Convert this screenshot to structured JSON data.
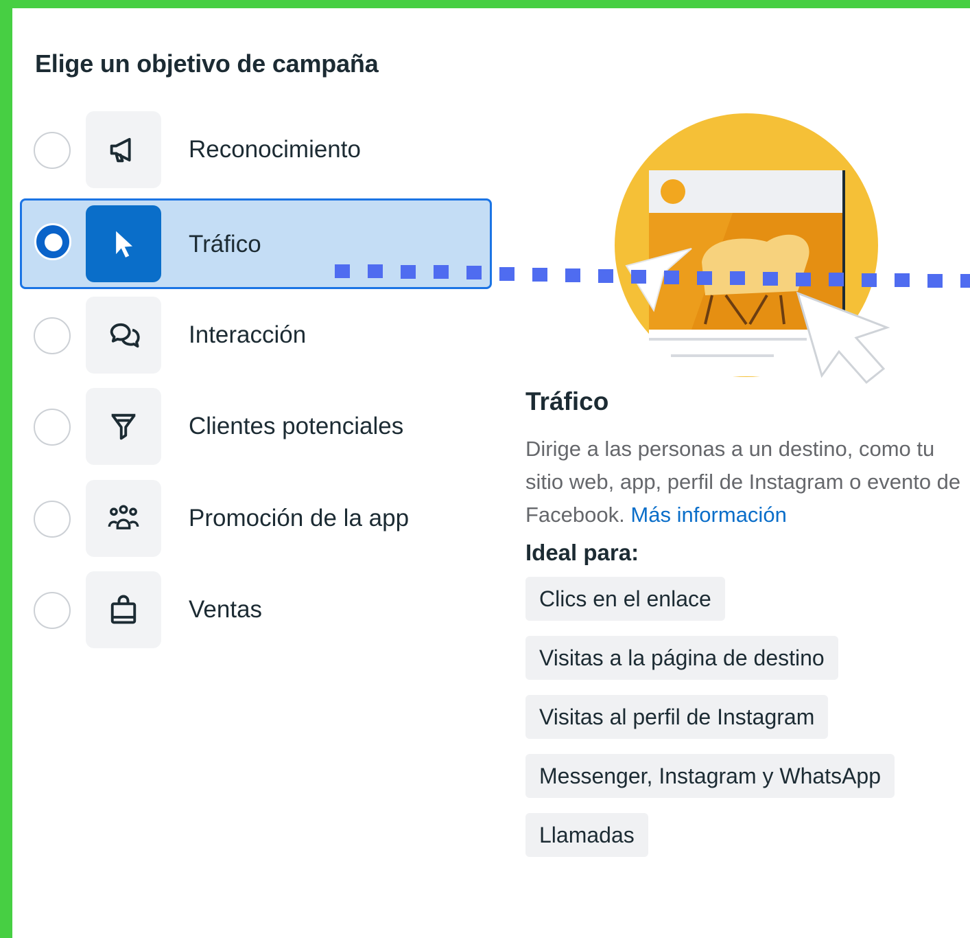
{
  "heading": "Elige un objetivo de campaña",
  "objectives": [
    {
      "label": "Reconocimiento",
      "icon": "megaphone-icon",
      "selected": false
    },
    {
      "label": "Tráfico",
      "icon": "cursor-icon",
      "selected": true
    },
    {
      "label": "Interacción",
      "icon": "chat-bubbles-icon",
      "selected": false
    },
    {
      "label": "Clientes potenciales",
      "icon": "funnel-icon",
      "selected": false
    },
    {
      "label": "Promoción de la app",
      "icon": "people-group-icon",
      "selected": false
    },
    {
      "label": "Ventas",
      "icon": "shopping-bag-icon",
      "selected": false
    }
  ],
  "detail": {
    "title": "Tráfico",
    "description": "Dirige a las personas a un destino, como tu sitio web, app, perfil de Instagram o evento de Facebook.",
    "more_link": "Más información",
    "ideal_label": "Ideal para:",
    "ideal_items": [
      "Clics en el enlace",
      "Visitas a la página de destino",
      "Visitas al perfil de Instagram",
      "Messenger, Instagram y WhatsApp",
      "Llamadas"
    ]
  },
  "colors": {
    "frame_green": "#47cf43",
    "selected_bg": "#c4ddf5",
    "selected_border": "#1b74e4",
    "accent_blue": "#0a6ec9",
    "annotation_dots": "#4f6cf0",
    "illustration_yellow": "#f5c037"
  }
}
